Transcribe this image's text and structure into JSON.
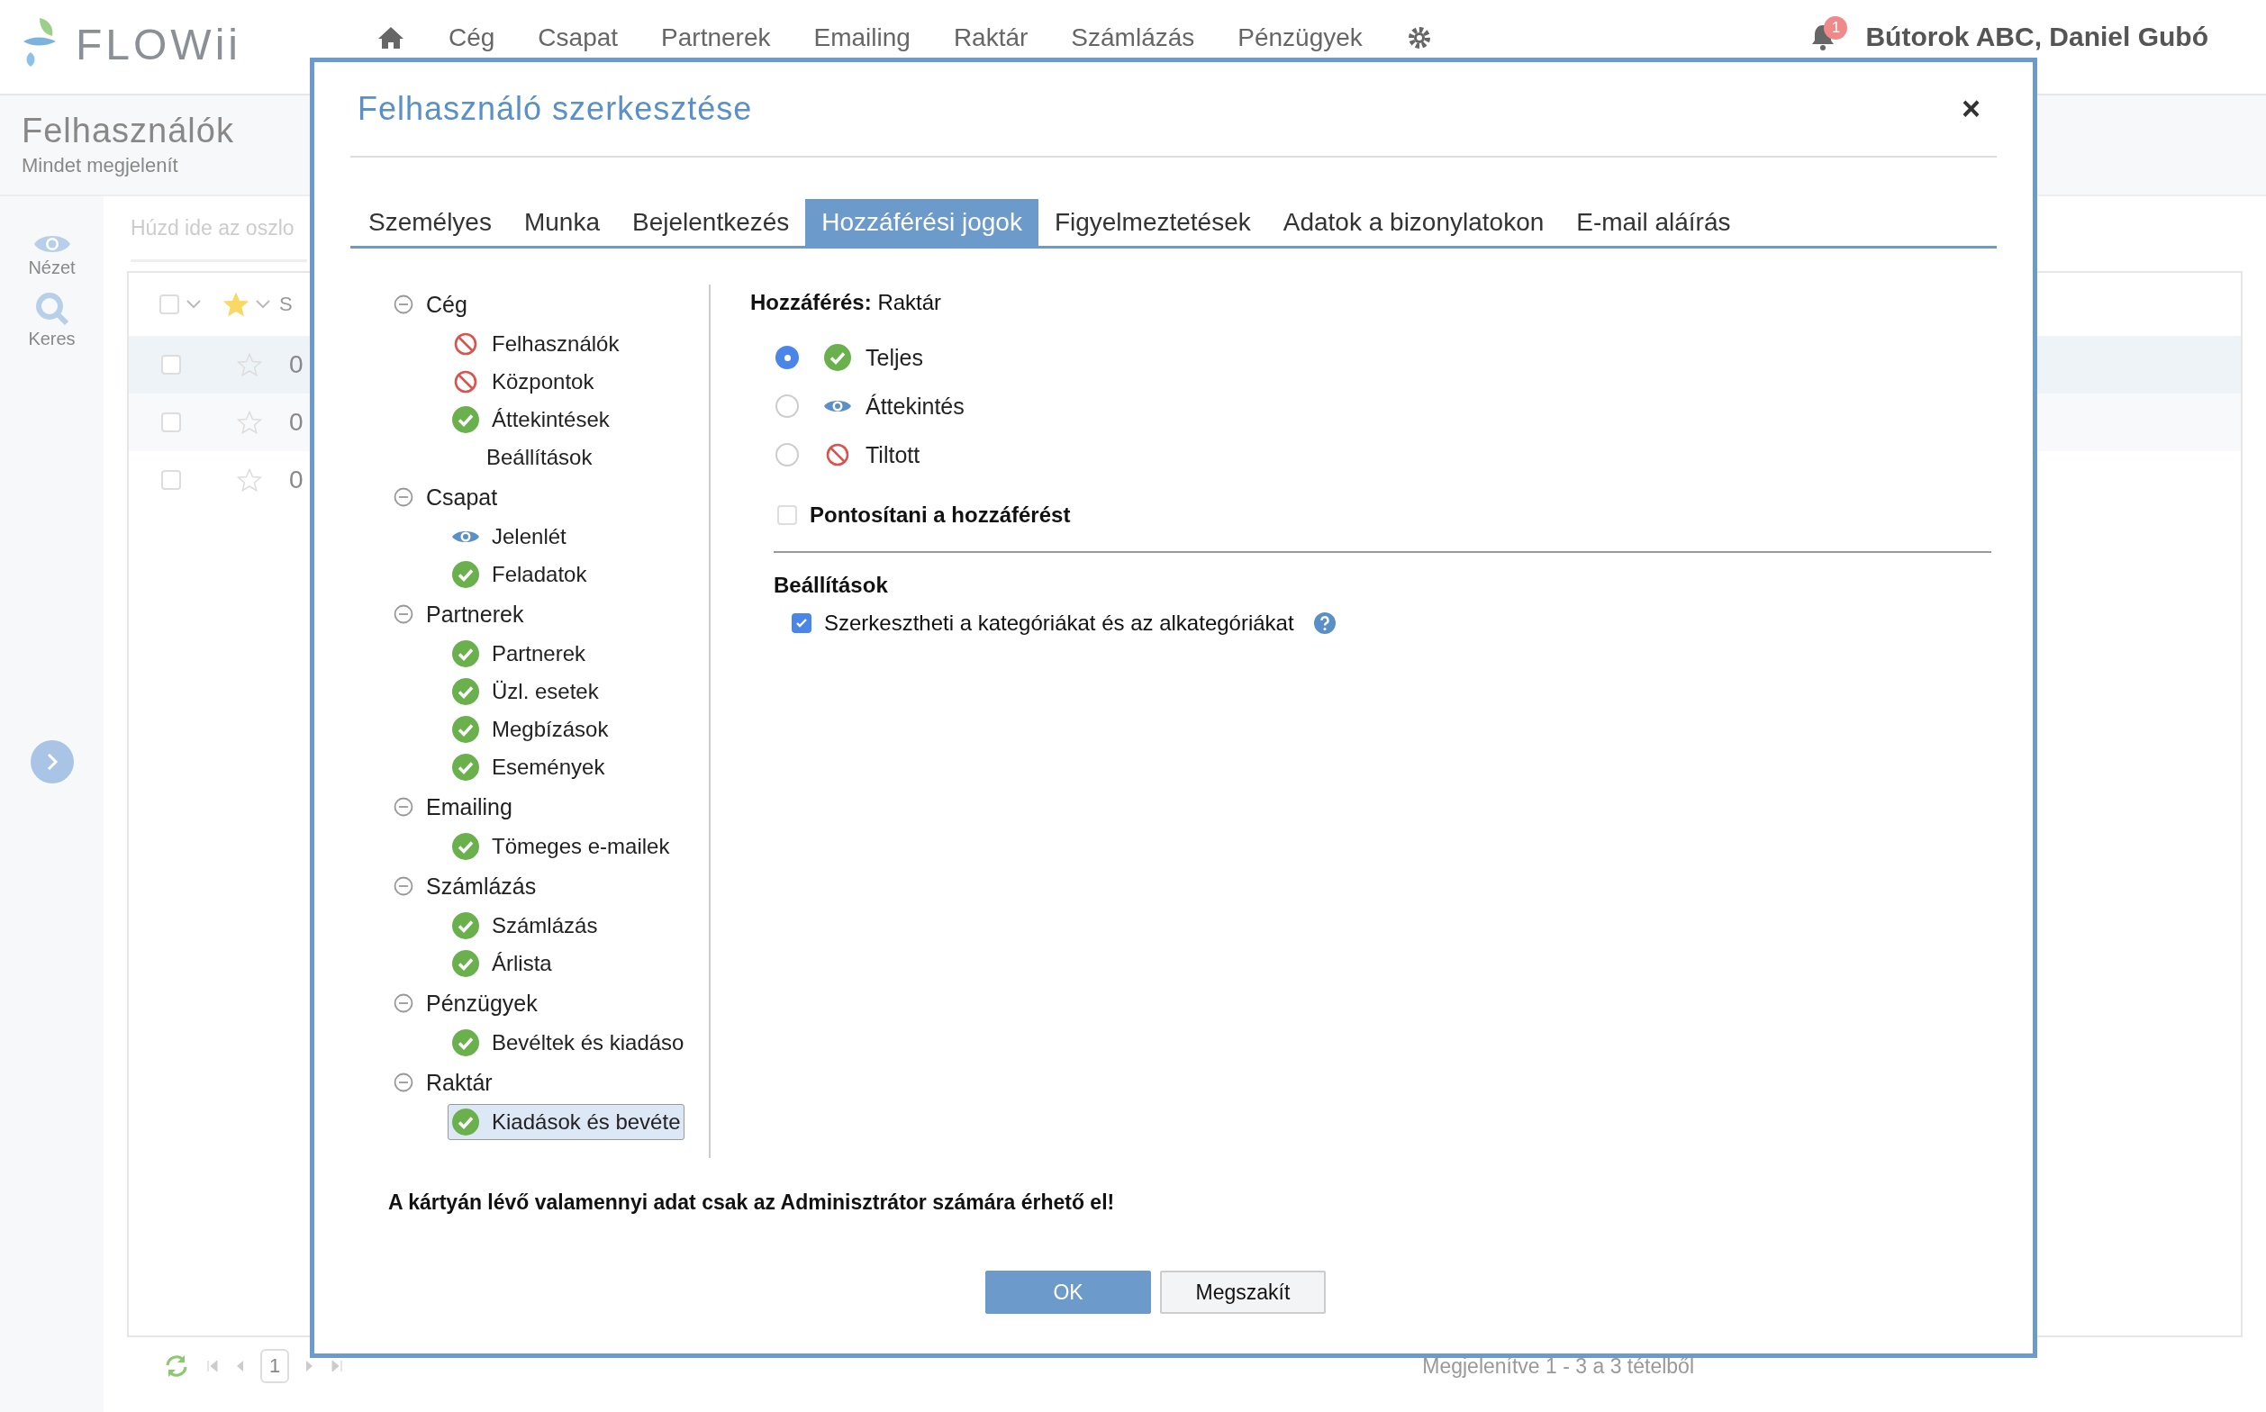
{
  "app": {
    "logo": "FLOWii",
    "nav": [
      {
        "label": "Cég"
      },
      {
        "label": "Csapat"
      },
      {
        "label": "Partnerek"
      },
      {
        "label": "Emailing"
      },
      {
        "label": "Raktár"
      },
      {
        "label": "Számlázás"
      },
      {
        "label": "Pénzügyek"
      }
    ],
    "notifications": "1",
    "account": "Bútorok ABC, Daniel Gubó"
  },
  "page": {
    "title": "Felhasználók",
    "subtitle": "Mindet megjelenít"
  },
  "rail": [
    {
      "label": "Nézet",
      "kind": "eye"
    },
    {
      "label": "Keres",
      "kind": "search"
    }
  ],
  "grid": {
    "all_checked": false,
    "group_placeholder": "Húzd ide az oszlo",
    "column_3": "S",
    "rows": [
      {
        "selected": true,
        "checked": false,
        "starred": false,
        "column_3": "0"
      },
      {
        "selected": false,
        "checked": false,
        "starred": false,
        "column_3": "0"
      },
      {
        "selected": false,
        "checked": false,
        "starred": false,
        "column_3": "0"
      }
    ],
    "page": "1",
    "summary": "Megjelenítve 1 - 3 a 3 tételből"
  },
  "dialog": {
    "title": "Felhasználó szerkesztése",
    "close": "×",
    "tabs": [
      {
        "label": "Személyes",
        "selected": false
      },
      {
        "label": "Munka",
        "selected": false
      },
      {
        "label": "Bejelentkezés",
        "selected": false
      },
      {
        "label": "Hozzáférési jogok",
        "selected": true
      },
      {
        "label": "Figyelmeztetések",
        "selected": false
      },
      {
        "label": "Adatok a bizonylatokon",
        "selected": false
      },
      {
        "label": "E-mail aláírás",
        "selected": false
      }
    ],
    "tree": [
      {
        "label": "Cég",
        "expanded": true,
        "children": [
          {
            "label": "Felhasználók",
            "kind": "denied",
            "selected": false
          },
          {
            "label": "Központok",
            "kind": "denied",
            "selected": false
          },
          {
            "label": "Áttekintések",
            "kind": "full",
            "selected": false
          },
          {
            "label": "Beállítások",
            "kind": "plain",
            "selected": false
          }
        ]
      },
      {
        "label": "Csapat",
        "expanded": true,
        "children": [
          {
            "label": "Jelenlét",
            "kind": "view",
            "selected": false
          },
          {
            "label": "Feladatok",
            "kind": "full",
            "selected": false
          }
        ]
      },
      {
        "label": "Partnerek",
        "expanded": true,
        "children": [
          {
            "label": "Partnerek",
            "kind": "full",
            "selected": false
          },
          {
            "label": "Üzl. esetek",
            "kind": "full",
            "selected": false
          },
          {
            "label": "Megbízások",
            "kind": "full",
            "selected": false
          },
          {
            "label": "Események",
            "kind": "full",
            "selected": false
          }
        ]
      },
      {
        "label": "Emailing",
        "expanded": true,
        "children": [
          {
            "label": "Tömeges e-mailek",
            "kind": "full",
            "selected": false
          }
        ]
      },
      {
        "label": "Számlázás",
        "expanded": true,
        "children": [
          {
            "label": "Számlázás",
            "kind": "full",
            "selected": false
          },
          {
            "label": "Árlista",
            "kind": "full",
            "selected": false
          }
        ]
      },
      {
        "label": "Pénzügyek",
        "expanded": true,
        "children": [
          {
            "label": "Bevéltek és kiadáso",
            "kind": "full",
            "selected": false
          }
        ]
      },
      {
        "label": "Raktár",
        "expanded": true,
        "children": [
          {
            "label": "Kiadások és bevéte",
            "kind": "full",
            "selected": true
          }
        ]
      }
    ],
    "detail": {
      "heading": "**Hozzáférés:** Raktár",
      "options": [
        {
          "label": "Teljes",
          "kind": "full",
          "selected": true
        },
        {
          "label": "Áttekintés",
          "kind": "view",
          "selected": false
        },
        {
          "label": "Tiltott",
          "kind": "denied",
          "selected": false
        }
      ],
      "refine": {
        "label": "Pontosítani a hozzáférést",
        "checked": false
      },
      "settings_title": "Beállítások",
      "settings": [
        {
          "label": "Szerkesztheti a kategóriákat és az alkategóriákat",
          "checked": true,
          "help": true
        }
      ]
    },
    "warning": "A kártyán lévő valamennyi adat csak az Adminisztrátor számára érhető el!",
    "buttons": [
      {
        "label": "OK",
        "kind": "primary"
      },
      {
        "label": "Megszakít",
        "kind": "secondary"
      }
    ]
  }
}
